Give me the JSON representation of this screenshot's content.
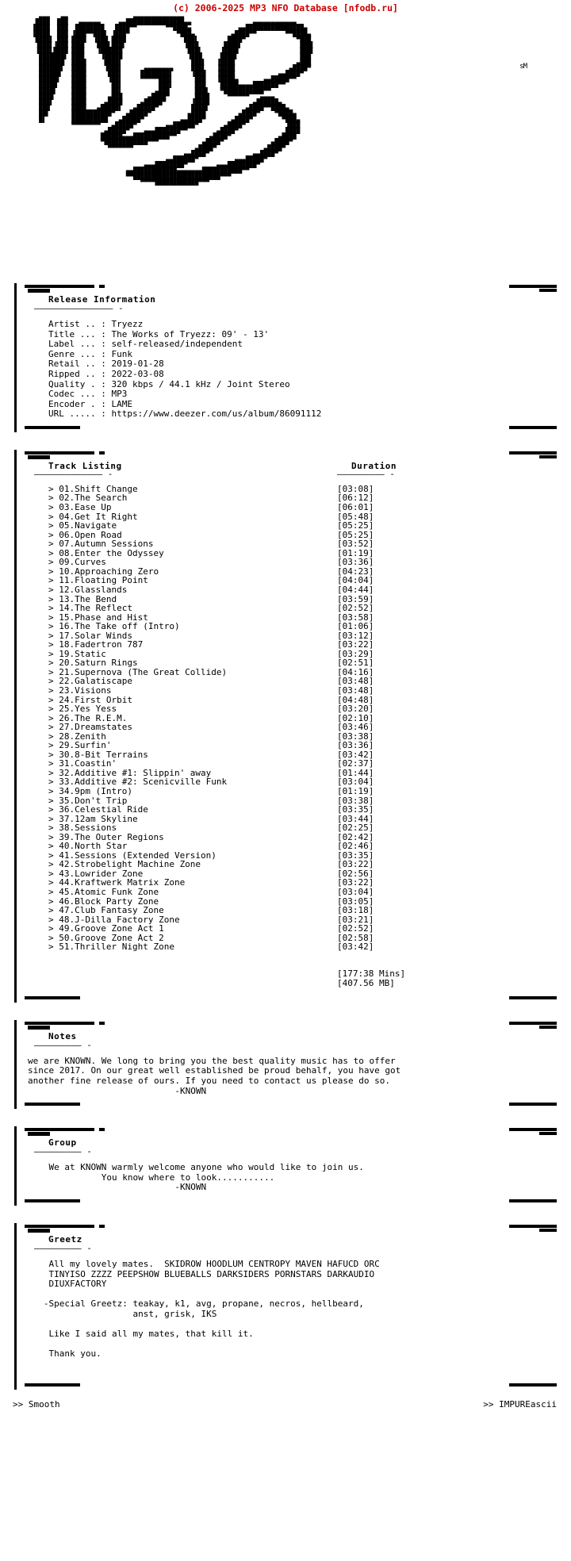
{
  "topbar": {
    "copyright": "(c) 2006-2025 MP3 NFO Database [nfodb.ru]"
  },
  "logo": {
    "group_name": "KNOWN",
    "trademark": "sM",
    "ascii_art": "         ▄▄▄   ▄▄                  ▄▄▄▄▄▄▄▄▄▄▄▄▄▄                                    \n        ████  ███   ▄▄▄▄▄▄     ▄▄████████████████▄▄                 ▄▄▄▄▄▄▄▄▄▄▄▄     \n       ▐████  ███  ████████   ████▀▀        ▀▀████▄             ▄▄████████████████▄  \n       ▐████  ███ ▐███▀▀███▌ ▐███▀             ▀███▄          ▄████▀▀        ▀▀████▄ \n        ████▌ ███ ████  ▐███ ████                ███▌        ████▀              ▀███ \n        ▐███▌▐███ ███▌   ███▌███▌                ▐███       ████▌                ███▌\n        ▐███▌████ ███▌   ▐██████                  ███▌     ▐████                 ███▌\n         ███████▌ ███▌    ▐█████                  ▐███     ████▌                 ███ \n         ███████  ████     ████▌                   ███▌   ▐████                 ▄███ \n         ██████▌  ████     ▐███▌      ▄▄▄▄▄▄▄▄     ███▌   ▐████               ▄████▀ \n         ██████   ████      ███▌     ████████▌     ▐███   ▐████            ▄▄████▀   \n         █████▌   ████      ▐██▌     ▀▀▀▀▀███▌      ███   ▐████▄       ▄▄█████▀▀     \n         █████    ████       ██▌          ███▌      ███    █████▄▄▄▄███████▀▀        \n         ████▌    ████       ██▌         ▄███       ███▌   ▀███████████▀▀            \n         ████     ████      ▄███       ▄████▀       ████     ▀▀▀▀▀▀   ▄▄▄▄           \n         ███▌     ████     ▄████     ▄█████▀       ▐████            ▄██████▄         \n         ███      ████   ▄█████▌   ▄█████▀         ████▌          ▄████▀▀████▄       \n         ██▌      ███████████▀   ▄█████▀          ▄████         ▄████▀    ▀████▄     \n         █▌       ██████████   ▄█████▀          ▄▄████▀       ▄████▀        ▀███▄    \n                  ▀▀▀▀▀▀▀▀   ▄█████▀        ▄▄██████▀       ▄████▀           ▐███    \n                           ▄█████▀    ▄▄▄███████▀▀        ▄████▀             ████    \n                          ██████▄▄▄██████████▀▀         ▄████▀             ▄████     \n                          ▀████████████▀▀▀            ▄████▀             ▄████▀      \n                            ▀▀▀▀▀▀▀                 ▄████▀             ▄████▀        \n                                                 ▄▄████▀            ▄▄████▀          \n                                            ▄▄██████▀          ▄▄▄█████▀             \n                                      ▄▄▄████████▀        ▄▄▄████████▀               \n                                 ▄▄████████████▄▄▄▄▄▄▄███████████▀▀                  \n                                 ▀▀████████████████████████▀▀▀                       \n                                     ▀▀▀▀████████████▀▀▀                             "
  },
  "release_information": {
    "title": "Release Information",
    "underline": "––––––––––––––– -",
    "fields": [
      {
        "label": "Artist ..",
        "value": "Tryezz"
      },
      {
        "label": "Title ...",
        "value": "The Works of Tryezz: 09' - 13'"
      },
      {
        "label": "Label ...",
        "value": "self-released/independent"
      },
      {
        "label": "Genre ...",
        "value": "Funk"
      },
      {
        "label": "Retail ..",
        "value": "2019-01-28"
      },
      {
        "label": "Ripped ..",
        "value": "2022-03-08"
      },
      {
        "label": "Quality .",
        "value": "320 kbps / 44.1 kHz / Joint Stereo"
      },
      {
        "label": "Codec ...",
        "value": "MP3"
      },
      {
        "label": "Encoder .",
        "value": "LAME"
      },
      {
        "label": "URL .....",
        "value": "https://www.deezer.com/us/album/86091112"
      }
    ]
  },
  "track_listing": {
    "title": "Track Listing",
    "underline": "––––––––––––– -",
    "duration_title": "Duration",
    "duration_underline": "––––––––– -",
    "bullet": ">",
    "tracks": [
      {
        "no": "01.",
        "name": "Shift Change",
        "duration": "[03:08]"
      },
      {
        "no": "02.",
        "name": "The Search",
        "duration": "[06:12]"
      },
      {
        "no": "03.",
        "name": "Ease Up",
        "duration": "[06:01]"
      },
      {
        "no": "04.",
        "name": "Get It Right",
        "duration": "[05:48]"
      },
      {
        "no": "05.",
        "name": "Navigate",
        "duration": "[05:25]"
      },
      {
        "no": "06.",
        "name": "Open Road",
        "duration": "[05:25]"
      },
      {
        "no": "07.",
        "name": "Autumn Sessions",
        "duration": "[03:52]"
      },
      {
        "no": "08.",
        "name": "Enter the Odyssey",
        "duration": "[01:19]"
      },
      {
        "no": "09.",
        "name": "Curves",
        "duration": "[03:36]"
      },
      {
        "no": "10.",
        "name": "Approaching Zero",
        "duration": "[04:23]"
      },
      {
        "no": "11.",
        "name": "Floating Point",
        "duration": "[04:04]"
      },
      {
        "no": "12.",
        "name": "Glasslands",
        "duration": "[04:44]"
      },
      {
        "no": "13.",
        "name": "The Bend",
        "duration": "[03:59]"
      },
      {
        "no": "14.",
        "name": "The Reflect",
        "duration": "[02:52]"
      },
      {
        "no": "15.",
        "name": "Phase and Hist",
        "duration": "[03:58]"
      },
      {
        "no": "16.",
        "name": "The Take off (Intro)",
        "duration": "[01:06]"
      },
      {
        "no": "17.",
        "name": "Solar Winds",
        "duration": "[03:12]"
      },
      {
        "no": "18.",
        "name": "Fadertron 787",
        "duration": "[03:22]"
      },
      {
        "no": "19.",
        "name": "Static",
        "duration": "[03:29]"
      },
      {
        "no": "20.",
        "name": "Saturn Rings",
        "duration": "[02:51]"
      },
      {
        "no": "21.",
        "name": "Supernova (The Great Collide)",
        "duration": "[04:16]"
      },
      {
        "no": "22.",
        "name": "Galatiscape",
        "duration": "[03:48]"
      },
      {
        "no": "23.",
        "name": "Visions",
        "duration": "[03:48]"
      },
      {
        "no": "24.",
        "name": "First Orbit",
        "duration": "[04:48]"
      },
      {
        "no": "25.",
        "name": "Yes Yess",
        "duration": "[03:20]"
      },
      {
        "no": "26.",
        "name": "The R.E.M.",
        "duration": "[02:10]"
      },
      {
        "no": "27.",
        "name": "Dreamstates",
        "duration": "[03:46]"
      },
      {
        "no": "28.",
        "name": "Zenith",
        "duration": "[03:38]"
      },
      {
        "no": "29.",
        "name": "Surfin'",
        "duration": "[03:36]"
      },
      {
        "no": "30.",
        "name": "8-Bit Terrains",
        "duration": "[03:42]"
      },
      {
        "no": "31.",
        "name": "Coastin'",
        "duration": "[02:37]"
      },
      {
        "no": "32.",
        "name": "Additive #1: Slippin' away",
        "duration": "[01:44]"
      },
      {
        "no": "33.",
        "name": "Additive #2: Scenicville Funk",
        "duration": "[03:04]"
      },
      {
        "no": "34.",
        "name": "9pm (Intro)",
        "duration": "[01:19]"
      },
      {
        "no": "35.",
        "name": "Don't Trip",
        "duration": "[03:38]"
      },
      {
        "no": "36.",
        "name": "Celestial Ride",
        "duration": "[03:35]"
      },
      {
        "no": "37.",
        "name": "12am Skyline",
        "duration": "[03:44]"
      },
      {
        "no": "38.",
        "name": "Sessions",
        "duration": "[02:25]"
      },
      {
        "no": "39.",
        "name": "The Outer Regions",
        "duration": "[02:42]"
      },
      {
        "no": "40.",
        "name": "North Star",
        "duration": "[02:46]"
      },
      {
        "no": "41.",
        "name": "Sessions (Extended Version)",
        "duration": "[03:35]"
      },
      {
        "no": "42.",
        "name": "Strobelight Machine Zone",
        "duration": "[03:22]"
      },
      {
        "no": "43.",
        "name": "Lowrider Zone",
        "duration": "[02:56]"
      },
      {
        "no": "44.",
        "name": "Kraftwerk Matrix Zone",
        "duration": "[03:22]"
      },
      {
        "no": "45.",
        "name": "Atomic Funk Zone",
        "duration": "[03:04]"
      },
      {
        "no": "46.",
        "name": "Block Party Zone",
        "duration": "[03:05]"
      },
      {
        "no": "47.",
        "name": "Club Fantasy Zone",
        "duration": "[03:18]"
      },
      {
        "no": "48.",
        "name": "J-Dilla Factory Zone",
        "duration": "[03:21]"
      },
      {
        "no": "49.",
        "name": "Groove Zone Act 1",
        "duration": "[02:52]"
      },
      {
        "no": "50.",
        "name": "Groove Zone Act 2",
        "duration": "[02:58]"
      },
      {
        "no": "51.",
        "name": "Thriller Night Zone",
        "duration": "[03:42]"
      }
    ],
    "total_time": "[177:38 Mins]",
    "total_size": "[407.56 MB]"
  },
  "notes": {
    "title": "Notes",
    "underline": "––––––––– -",
    "body": "we are KNOWN. We long to bring you the best quality music has to offer\nsince 2017. On our great well established be proud behalf, you have got\nanother fine release of ours. If you need to contact us please do so.\n                            -KNOWN"
  },
  "group": {
    "title": "Group",
    "underline": "––––––––– -",
    "body": "    We at KNOWN warmly welcome anyone who would like to join us.\n              You know where to look...........\n                            -KNOWN"
  },
  "greetz": {
    "title": "Greetz",
    "underline": "––––––––– -",
    "body": "    All my lovely mates.  SKIDROW HOODLUM CENTROPY MAVEN HAFUCD ORC\n    TINYISO ZZZZ PEEPSHOW BLUEBALLS DARKSIDERS PORNSTARS DARKAUDIO\n    DIUXFACTORY\n\n   -Special Greetz: teakay, k1, avg, propane, necros, hellbeard,\n                    anst, grisk, IKS\n\n    Like I said all my mates, that kill it.\n\n    Thank you."
  },
  "footer": {
    "left": ">> Smooth",
    "right": ">> IMPUREascii"
  }
}
